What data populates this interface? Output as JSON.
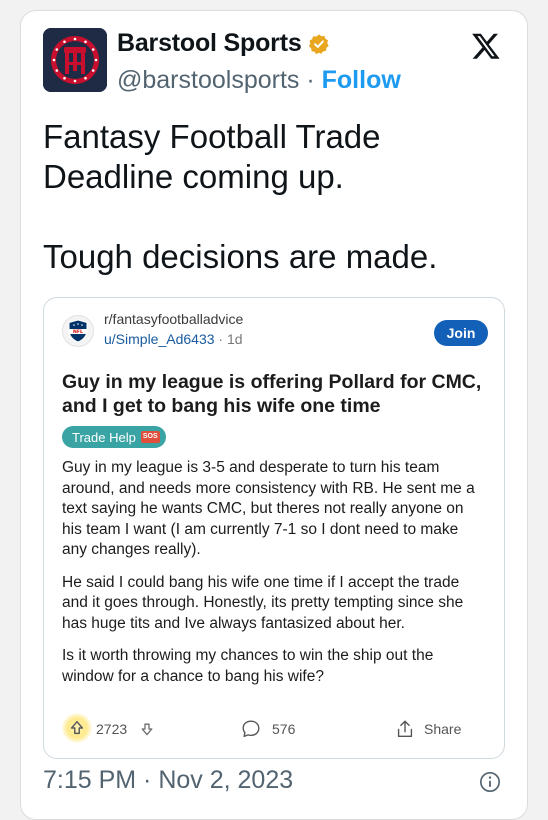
{
  "account": {
    "name": "Barstool Sports",
    "handle": "@barstoolsports",
    "separator": "·",
    "follow_label": "Follow",
    "verified_badge_color": "#e8a71e"
  },
  "platform_icon": "x-logo-icon",
  "tweet": {
    "lines": [
      "Fantasy Football Trade Deadline coming up.",
      "Tough decisions are made."
    ],
    "timestamp": "7:15 PM · Nov 2, 2023"
  },
  "embed": {
    "subreddit": "r/fantasyfootballadvice",
    "user": "u/Simple_Ad6433",
    "age_separator": "·",
    "age": "1d",
    "join_label": "Join",
    "title": "Guy in my league is offering Pollard for CMC, and I get to bang his wife one time",
    "flair": {
      "label": "Trade Help",
      "emoji": "SOS",
      "color": "#3aa3a3"
    },
    "paragraphs": [
      "Guy in my league is 3-5 and desperate to turn his team around, and needs more consistency with RB. He sent me a text saying he wants CMC, but theres not really anyone on his team I want (I am currently 7-1 so I dont need to make any changes really).",
      "He said I could bang his wife one time if I accept the trade and it goes through. Honestly, its pretty tempting since she has huge tits and Ive always fantasized about her.",
      "Is it worth throwing my chances to win the ship out the window for a chance to bang his wife?"
    ],
    "upvotes": "2723",
    "comments": "576",
    "share_label": "Share"
  },
  "colors": {
    "accent": "#1d9bf0",
    "join": "#1260b8",
    "muted": "#536471"
  }
}
